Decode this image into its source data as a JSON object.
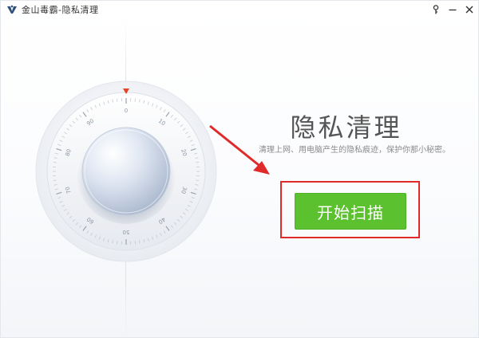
{
  "window": {
    "title": "金山毒霸-隐私清理"
  },
  "titlebar_icons": [
    "logo-icon",
    "key-icon",
    "minimize-icon",
    "close-icon"
  ],
  "dial": {
    "ticks": [
      "0",
      "10",
      "20",
      "30",
      "40",
      "50",
      "60",
      "70",
      "80",
      "90"
    ]
  },
  "main": {
    "headline": "隐私清理",
    "subtitle": "清理上网、用电脑产生的隐私痕迹，保护你那小秘密。",
    "start_button": "开始扫描"
  },
  "colors": {
    "accent_green": "#5cc12f",
    "annotation_red": "#e02a2a",
    "pointer_red": "#e8442a"
  }
}
